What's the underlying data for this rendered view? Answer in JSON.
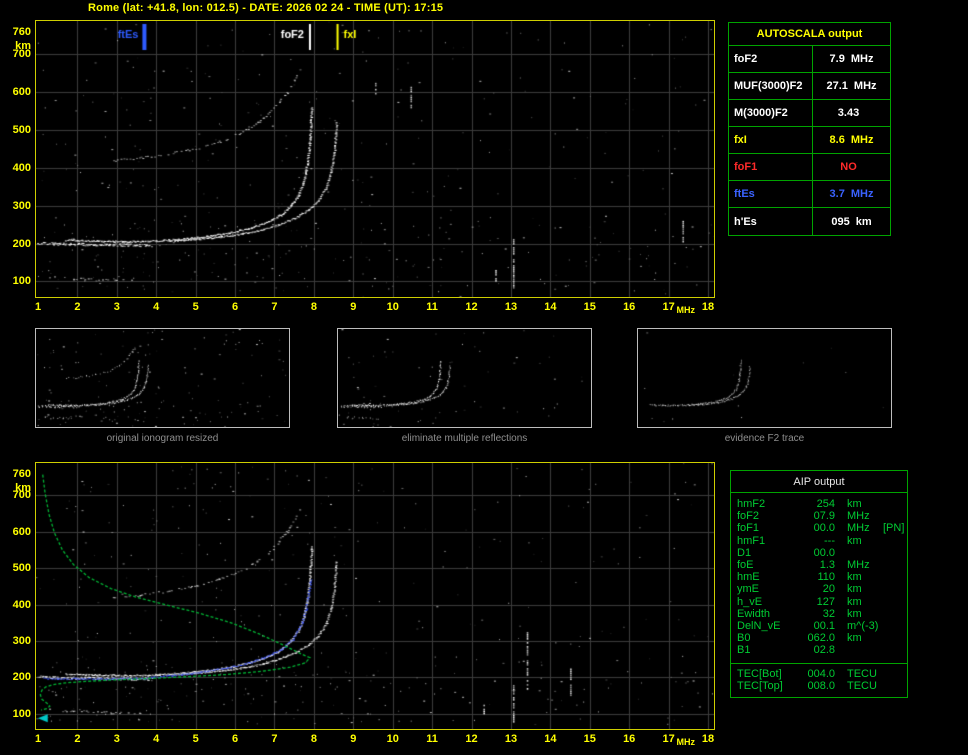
{
  "title": "Rome (lat: +41.8, lon: 012.5) - DATE: 2026 02 24 - TIME (UT): 17:15",
  "autoscala": {
    "title": "AUTOSCALA output",
    "rows": [
      {
        "label": "foF2",
        "value": "7.9",
        "unit": "MHz",
        "color": "#ffffff"
      },
      {
        "label": "MUF(3000)F2",
        "value": "27.1",
        "unit": "MHz",
        "color": "#ffffff"
      },
      {
        "label": "M(3000)F2",
        "value": "3.43",
        "unit": "",
        "color": "#ffffff"
      },
      {
        "label": "fxI",
        "value": "8.6",
        "unit": "MHz",
        "color": "#ffff00"
      },
      {
        "label": "foF1",
        "value": "NO",
        "unit": "",
        "color": "#ff2a2a"
      },
      {
        "label": "ftEs",
        "value": "3.7",
        "unit": "MHz",
        "color": "#3a62ff"
      },
      {
        "label": "h'Es",
        "value": "095",
        "unit": "km",
        "color": "#ffffff"
      }
    ]
  },
  "aip": {
    "title": "AIP output",
    "rows": [
      {
        "label": "hmF2",
        "value": "254",
        "unit": "km"
      },
      {
        "label": "foF2",
        "value": "07.9",
        "unit": "MHz"
      },
      {
        "label": "foF1",
        "value": "00.0",
        "unit": "MHz",
        "note": "[PN]"
      },
      {
        "label": "hmF1",
        "value": "---",
        "unit": "km"
      },
      {
        "label": "D1",
        "value": "00.0",
        "unit": ""
      },
      {
        "label": "foE",
        "value": "1.3",
        "unit": "MHz"
      },
      {
        "label": "hmE",
        "value": "110",
        "unit": "km"
      },
      {
        "label": "ymE",
        "value": "20",
        "unit": "km"
      },
      {
        "label": "h_vE",
        "value": "127",
        "unit": "km"
      },
      {
        "label": "Ewidth",
        "value": "32",
        "unit": "km"
      },
      {
        "label": "DelN_vE",
        "value": "00.1",
        "unit": "m^(-3)"
      },
      {
        "label": "B0",
        "value": "062.0",
        "unit": "km"
      },
      {
        "label": "B1",
        "value": "02.8",
        "unit": ""
      }
    ],
    "tec_rows": [
      {
        "label": "TEC[Bot]",
        "value": "004.0",
        "unit": "TECU"
      },
      {
        "label": "TEC[Top]",
        "value": "008.0",
        "unit": "TECU"
      }
    ]
  },
  "chart_data": {
    "type": "scatter",
    "title": "Autoscala ionogram (virtual height vs frequency) with restored profile",
    "x_label": "MHz",
    "y_label": "km",
    "x_ticks": [
      1,
      2,
      3,
      4,
      5,
      6,
      7,
      8,
      9,
      10,
      11,
      12,
      13,
      14,
      15,
      16,
      17,
      18
    ],
    "y_ticks": [
      760,
      700,
      600,
      500,
      400,
      300,
      200,
      100
    ],
    "x_range": [
      1,
      18.05
    ],
    "y_range": [
      72,
      778
    ],
    "grid_color": "#3d3d3d",
    "markers": [
      {
        "name": "ftEs",
        "mhz": 3.7,
        "color": "#2e5bff",
        "width": 4,
        "label_side": "left"
      },
      {
        "name": "foF2",
        "mhz": 7.9,
        "color": "#ffffff",
        "width": 2,
        "label_side": "left"
      },
      {
        "name": "fxI",
        "mhz": 8.6,
        "color": "#ffff00",
        "width": 2,
        "label_side": "right"
      }
    ],
    "traces": {
      "es": {
        "color": "#ffffff",
        "size": 2,
        "step": 1.1,
        "jitter": 2.6,
        "alpha": 1,
        "points": [
          [
            1.0,
            202
          ],
          [
            1.5,
            200
          ],
          [
            2.1,
            199
          ],
          [
            2.7,
            198
          ],
          [
            3.3,
            197
          ],
          [
            3.85,
            196
          ]
        ]
      },
      "es_low": {
        "color": "#ffffff",
        "size": 2,
        "step": 2.4,
        "jitter": 2.2,
        "alpha": 0.8,
        "skip": 0.35,
        "points": [
          [
            1.3,
            112
          ],
          [
            1.9,
            108
          ],
          [
            2.5,
            105
          ],
          [
            3.1,
            103
          ],
          [
            3.6,
            102
          ]
        ]
      },
      "f2o": {
        "color": "#ffffff",
        "size": 2,
        "step": 1.1,
        "jitter": 1.5,
        "alpha": 1,
        "points": [
          [
            1.7,
            210
          ],
          [
            2.5,
            207
          ],
          [
            3.3,
            206
          ],
          [
            4.0,
            208
          ],
          [
            4.7,
            213
          ],
          [
            5.3,
            220
          ],
          [
            5.9,
            230
          ],
          [
            6.4,
            242
          ],
          [
            6.8,
            257
          ],
          [
            7.15,
            276
          ],
          [
            7.4,
            300
          ],
          [
            7.6,
            330
          ],
          [
            7.73,
            365
          ],
          [
            7.82,
            410
          ],
          [
            7.88,
            465
          ],
          [
            7.93,
            560
          ]
        ]
      },
      "f2x": {
        "color": "#ffffff",
        "size": 2,
        "step": 1.2,
        "jitter": 1.4,
        "alpha": 0.95,
        "points": [
          [
            4.3,
            208
          ],
          [
            5.0,
            212
          ],
          [
            5.6,
            218
          ],
          [
            6.2,
            227
          ],
          [
            6.7,
            238
          ],
          [
            7.1,
            251
          ],
          [
            7.5,
            268
          ],
          [
            7.85,
            290
          ],
          [
            8.1,
            315
          ],
          [
            8.3,
            348
          ],
          [
            8.42,
            390
          ],
          [
            8.5,
            440
          ],
          [
            8.56,
            520
          ]
        ]
      },
      "hop2": {
        "color": "#ffffff",
        "size": 2,
        "step": 2.2,
        "jitter": 2.0,
        "alpha": 0.75,
        "skip": 0.3,
        "points": [
          [
            2.9,
            420
          ],
          [
            3.6,
            428
          ],
          [
            4.3,
            438
          ],
          [
            5.0,
            452
          ],
          [
            5.6,
            470
          ],
          [
            6.1,
            492
          ],
          [
            6.55,
            520
          ],
          [
            6.95,
            555
          ],
          [
            7.3,
            600
          ],
          [
            7.65,
            660
          ]
        ]
      },
      "blue_f2": {
        "color": "#3c55ff",
        "size": 2,
        "step": 1.4,
        "jitter": 1.6,
        "alpha": 0.95,
        "points": [
          [
            1.15,
            198
          ],
          [
            2.0,
            197
          ],
          [
            2.9,
            197
          ],
          [
            3.7,
            199
          ],
          [
            4.4,
            206
          ],
          [
            5.1,
            215
          ],
          [
            5.8,
            227
          ],
          [
            6.35,
            241
          ],
          [
            6.8,
            258
          ],
          [
            7.15,
            278
          ],
          [
            7.45,
            305
          ],
          [
            7.65,
            340
          ],
          [
            7.78,
            385
          ],
          [
            7.87,
            440
          ],
          [
            7.9,
            470
          ]
        ]
      },
      "profile": {
        "color": "#00b434",
        "style": "line",
        "width": 1.3,
        "dash": [
          3,
          2
        ],
        "points": [
          [
            1.12,
            757
          ],
          [
            1.18,
            706
          ],
          [
            1.28,
            648
          ],
          [
            1.42,
            596
          ],
          [
            1.62,
            550
          ],
          [
            1.9,
            510
          ],
          [
            2.3,
            474
          ],
          [
            2.85,
            444
          ],
          [
            3.5,
            420
          ],
          [
            4.3,
            398
          ],
          [
            5.1,
            376
          ],
          [
            5.9,
            350
          ],
          [
            6.6,
            320
          ],
          [
            7.2,
            290
          ],
          [
            7.65,
            266
          ],
          [
            7.9,
            254
          ],
          [
            7.78,
            240
          ],
          [
            7.4,
            228
          ],
          [
            6.7,
            217
          ],
          [
            5.8,
            208
          ],
          [
            4.8,
            202
          ],
          [
            3.8,
            197
          ],
          [
            2.9,
            193
          ],
          [
            2.2,
            189
          ],
          [
            1.7,
            185
          ],
          [
            1.38,
            180
          ],
          [
            1.2,
            174
          ],
          [
            1.1,
            165
          ],
          [
            1.06,
            152
          ],
          [
            1.1,
            140
          ],
          [
            1.22,
            130
          ],
          [
            1.3,
            121
          ],
          [
            1.22,
            114
          ],
          [
            1.08,
            110
          ]
        ]
      }
    },
    "plots": [
      {
        "canvas": "cv-top",
        "seed": 11,
        "markers": true,
        "layers": [
          "es",
          "es_low",
          "f2o",
          "f2x",
          "hop2"
        ],
        "noise": 460,
        "streaks": [
          [
            13.05,
            80,
            212
          ],
          [
            10.45,
            560,
            620
          ],
          [
            9.55,
            595,
            625
          ],
          [
            17.35,
            205,
            260
          ],
          [
            12.6,
            95,
            130
          ]
        ]
      },
      {
        "canvas": "cv-bottom",
        "seed": 23,
        "markers": false,
        "layers": [
          "es",
          "es_low",
          "f2o",
          "f2x",
          "hop2",
          "blue_f2",
          "profile"
        ],
        "noise": 440,
        "streaks": [
          [
            13.05,
            80,
            190
          ],
          [
            13.4,
            165,
            330
          ],
          [
            12.3,
            95,
            125
          ],
          [
            14.5,
            150,
            230
          ]
        ],
        "arrow": {
          "mhz": 1.12,
          "km": 88,
          "color": "#00c8c8"
        }
      }
    ],
    "thumbnails": [
      {
        "caption": "original ionogram resized",
        "seed": 31,
        "alpha": 1,
        "noise": 160,
        "layers": [
          "es",
          "es_low",
          "f2o",
          "f2x",
          "hop2"
        ]
      },
      {
        "caption": "eliminate multiple reflections",
        "seed": 41,
        "alpha": 1,
        "noise": 70,
        "layers": [
          "es",
          "es_low",
          "f2o",
          "f2x"
        ]
      },
      {
        "caption": "evidence F2 trace",
        "seed": 51,
        "alpha": 0.8,
        "noise": 14,
        "layers": [
          "f2o",
          "f2x"
        ]
      }
    ]
  }
}
